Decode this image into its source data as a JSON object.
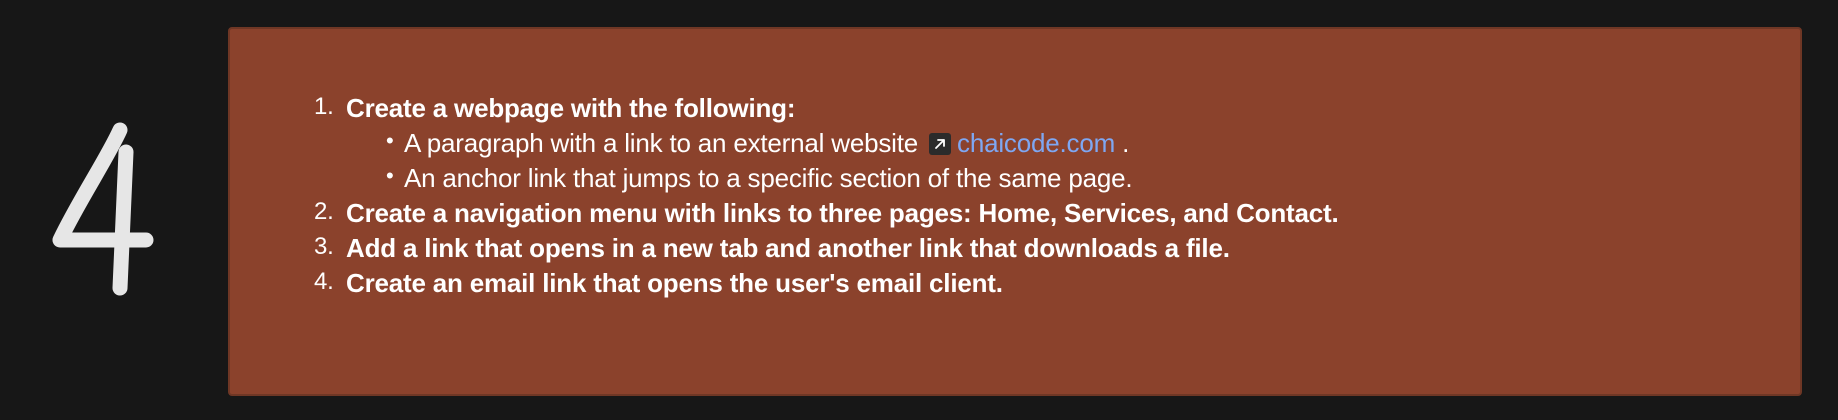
{
  "slide_number": "4",
  "colors": {
    "background": "#171717",
    "card": "#8b422c",
    "text": "#ffffff",
    "link": "#7ea7f2"
  },
  "tasks": [
    {
      "number": "1.",
      "title": "Create a webpage with the following:",
      "subitems": [
        {
          "text_before": "A paragraph with a link to an external website",
          "icon": "external-link-icon",
          "link_text": "chaicode.com",
          "text_after": "."
        },
        {
          "text": "An anchor link that jumps to a specific section of the same page."
        }
      ]
    },
    {
      "number": "2.",
      "title": "Create a navigation menu with links to three pages: Home, Services, and Contact."
    },
    {
      "number": "3.",
      "title": "Add a link that opens in a new tab and another link that downloads a file."
    },
    {
      "number": "4.",
      "title": "Create an email link that opens the user's email client."
    }
  ]
}
